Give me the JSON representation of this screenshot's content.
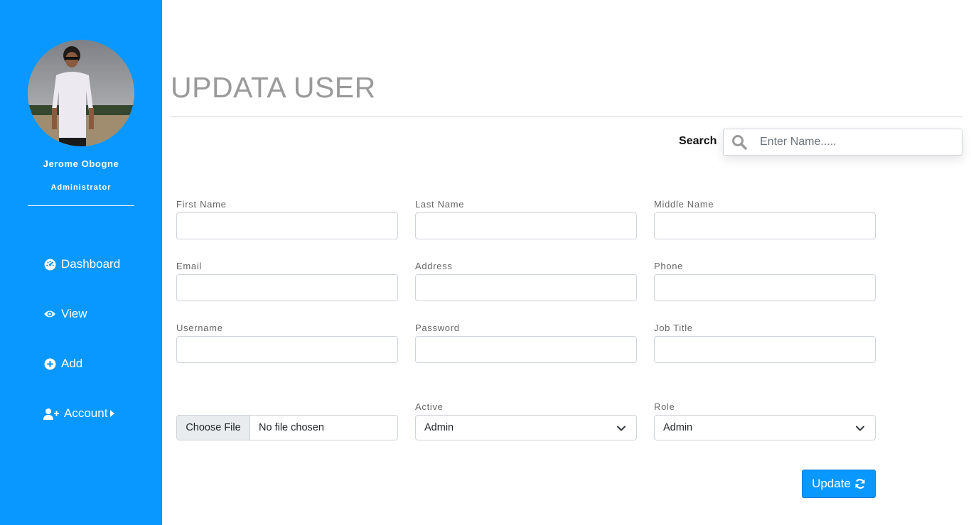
{
  "sidebar": {
    "user": {
      "name": "Jerome Obogne",
      "role": "Administrator"
    },
    "nav": [
      {
        "label": "Dashboard",
        "icon": "dashboard-icon"
      },
      {
        "label": "View",
        "icon": "eye-icon"
      },
      {
        "label": "Add",
        "icon": "plus-circle-icon"
      },
      {
        "label": "Account",
        "icon": "user-plus-icon"
      }
    ],
    "background_color": "#0898ff"
  },
  "page": {
    "title": "UPDATA USER"
  },
  "search": {
    "label": "Search",
    "placeholder": "Enter Name.....",
    "value": ""
  },
  "form": {
    "fields": [
      {
        "label": "First Name",
        "value": ""
      },
      {
        "label": "Last Name",
        "value": ""
      },
      {
        "label": "Middle Name",
        "value": ""
      },
      {
        "label": "Email",
        "value": ""
      },
      {
        "label": "Address",
        "value": ""
      },
      {
        "label": "Phone",
        "value": ""
      },
      {
        "label": "Username",
        "value": ""
      },
      {
        "label": "Password",
        "value": ""
      },
      {
        "label": "Job Title",
        "value": ""
      }
    ],
    "file": {
      "button_label": "Choose File",
      "status": "No file chosen"
    },
    "active": {
      "label": "Active",
      "selected": "Admin"
    },
    "role": {
      "label": "Role",
      "selected": "Admin"
    },
    "submit_label": "Update"
  },
  "colors": {
    "accent": "#0898ff",
    "title_gray": "#9a9a9a"
  }
}
